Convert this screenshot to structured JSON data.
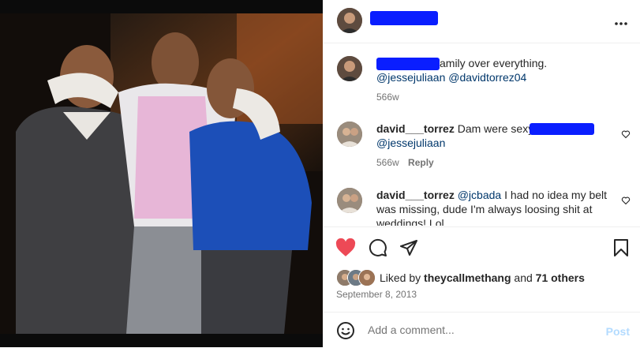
{
  "post": {
    "caption_visible": "amily over everything.",
    "caption_mentions": [
      "@jessejuliaan",
      "@davidtorrez04"
    ],
    "caption_time": "566w"
  },
  "comments": [
    {
      "username": "david___torrez",
      "text": "Dam were sexy.",
      "mention": "@jessejuliaan",
      "time": "566w",
      "reply_label": "Reply"
    },
    {
      "username": "david___torrez",
      "mention": "@jcbada",
      "text": "I had no idea my belt was missing, dude I'm always loosing shit at weddings! Lol"
    }
  ],
  "likes": {
    "prefix": "Liked by",
    "user": "theycallmethang",
    "joiner": "and",
    "others": "71 others"
  },
  "date": "September 8, 2013",
  "add_comment": {
    "placeholder": "Add a comment...",
    "post_label": "Post"
  },
  "icons": [
    "more-icon",
    "heart-icon",
    "comment-icon",
    "share-icon",
    "save-icon",
    "emoji-icon"
  ],
  "colors": {
    "liked_heart": "#ed4956",
    "mention": "#00376b",
    "redaction": "#0a1eff",
    "post_disabled": "#b3dbff"
  }
}
